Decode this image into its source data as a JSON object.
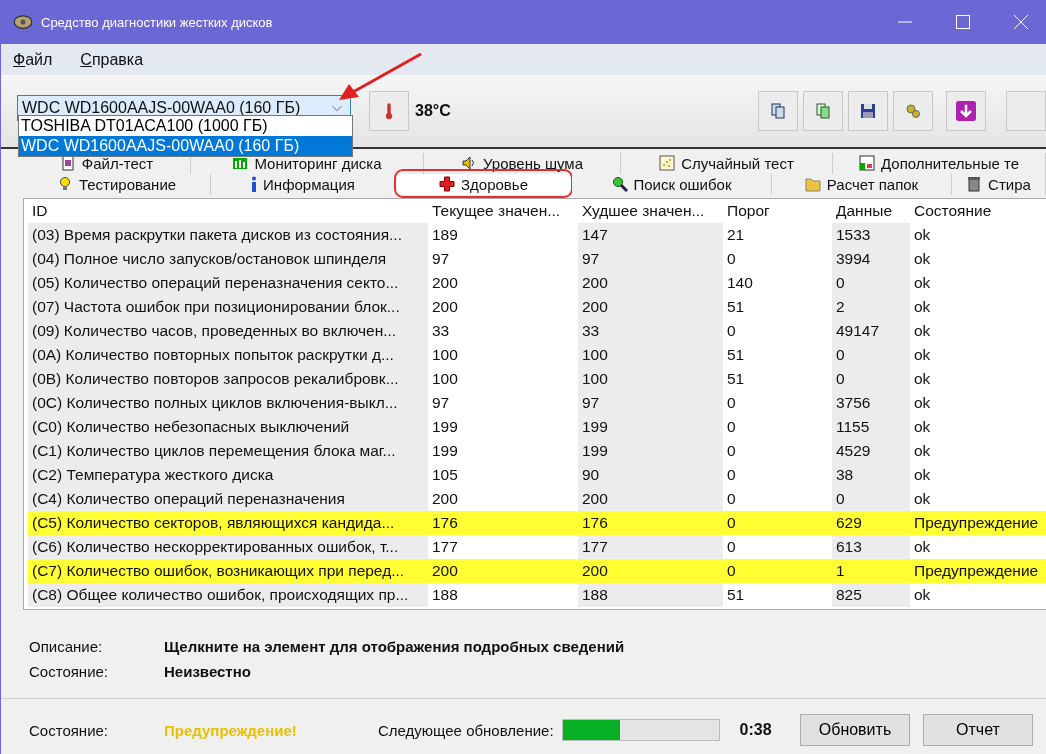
{
  "window": {
    "title": "Средство диагностики жестких дисков"
  },
  "menu": [
    {
      "label": "Файл"
    },
    {
      "label": "Справка"
    }
  ],
  "disk_select": {
    "value": "WDC WD1600AAJS-00WAA0 (160 ГБ)",
    "options": [
      {
        "label": "TOSHIBA DT01ACA100 (1000 ГБ)",
        "selected": false
      },
      {
        "label": "WDC WD1600AAJS-00WAA0 (160 ГБ)",
        "selected": true
      }
    ]
  },
  "temperature": "38°C",
  "tab_rows": [
    [
      {
        "label": "Файл-тест",
        "kind": "file",
        "selected": false
      },
      {
        "label": "Мониторинг диска",
        "kind": "monitor",
        "selected": false
      },
      {
        "label": "Уровень шума",
        "kind": "sound",
        "selected": false
      },
      {
        "label": "Случайный тест",
        "kind": "random",
        "selected": false
      },
      {
        "label": "Дополнительные те",
        "kind": "extra",
        "selected": false
      }
    ],
    [
      {
        "label": "Тестирование",
        "kind": "test",
        "selected": false
      },
      {
        "label": "Информация",
        "kind": "info",
        "selected": false
      },
      {
        "label": "Здоровье",
        "kind": "health",
        "selected": true
      },
      {
        "label": "Поиск ошибок",
        "kind": "search",
        "selected": false
      },
      {
        "label": "Расчет папок",
        "kind": "folder",
        "selected": false
      },
      {
        "label": "Стира",
        "kind": "erase",
        "selected": false
      }
    ]
  ],
  "table": {
    "columns": [
      "ID",
      "Текущее значен...",
      "Худшее значен...",
      "Порог",
      "Данные",
      "Состояние"
    ],
    "rows": [
      {
        "cells": [
          "(03) Время раскрутки пакета дисков из состояния...",
          "189",
          "147",
          "21",
          "1533",
          "ok"
        ],
        "warning": false
      },
      {
        "cells": [
          "(04) Полное число запусков/остановок шпинделя",
          "97",
          "97",
          "0",
          "3994",
          "ok"
        ],
        "warning": false
      },
      {
        "cells": [
          "(05) Количество операций переназначения секто...",
          "200",
          "200",
          "140",
          "0",
          "ok"
        ],
        "warning": false
      },
      {
        "cells": [
          "(07) Частота ошибок при позиционировании блок...",
          "200",
          "200",
          "51",
          "2",
          "ok"
        ],
        "warning": false
      },
      {
        "cells": [
          "(09) Количество часов, проведенных во включен...",
          "33",
          "33",
          "0",
          "49147",
          "ok"
        ],
        "warning": false
      },
      {
        "cells": [
          "(0A) Количество повторных попыток раскрутки д...",
          "100",
          "100",
          "51",
          "0",
          "ok"
        ],
        "warning": false
      },
      {
        "cells": [
          "(0B) Количество повторов запросов рекалибровк...",
          "100",
          "100",
          "51",
          "0",
          "ok"
        ],
        "warning": false
      },
      {
        "cells": [
          "(0C) Количество полных циклов включения-выкл...",
          "97",
          "97",
          "0",
          "3756",
          "ok"
        ],
        "warning": false
      },
      {
        "cells": [
          "(C0) Количество небезопасных выключений",
          "199",
          "199",
          "0",
          "1155",
          "ok"
        ],
        "warning": false
      },
      {
        "cells": [
          "(C1) Количество циклов перемещения блока маг...",
          "199",
          "199",
          "0",
          "4529",
          "ok"
        ],
        "warning": false
      },
      {
        "cells": [
          "(C2) Температура жесткого диска",
          "105",
          "90",
          "0",
          "38",
          "ok"
        ],
        "warning": false
      },
      {
        "cells": [
          "(C4) Количество операций переназначения",
          "200",
          "200",
          "0",
          "0",
          "ok"
        ],
        "warning": false
      },
      {
        "cells": [
          "(C5) Количество секторов, являющихся кандида...",
          "176",
          "176",
          "0",
          "629",
          "Предупреждение"
        ],
        "warning": true
      },
      {
        "cells": [
          "(C6) Количество нескорректированных ошибок, т...",
          "177",
          "177",
          "0",
          "613",
          "ok"
        ],
        "warning": false
      },
      {
        "cells": [
          "(C7) Количество ошибок, возникающих при перед...",
          "200",
          "200",
          "0",
          "1",
          "Предупреждение"
        ],
        "warning": true
      },
      {
        "cells": [
          "(C8) Общее количество ошибок, происходящих пр...",
          "188",
          "188",
          "51",
          "825",
          "ok"
        ],
        "warning": false
      }
    ]
  },
  "details": [
    {
      "label": "Описание:",
      "value": "Щелкните на элемент для отображения подробных сведений"
    },
    {
      "label": "Состояние:",
      "value": "Неизвестно"
    }
  ],
  "status": {
    "label": "Состояние:",
    "value": "Предупреждение!",
    "next_update_label": "Следующее обновление:",
    "level": 0.37,
    "time": "0:38"
  },
  "buttons": [
    "Обновить",
    "Отчет"
  ]
}
